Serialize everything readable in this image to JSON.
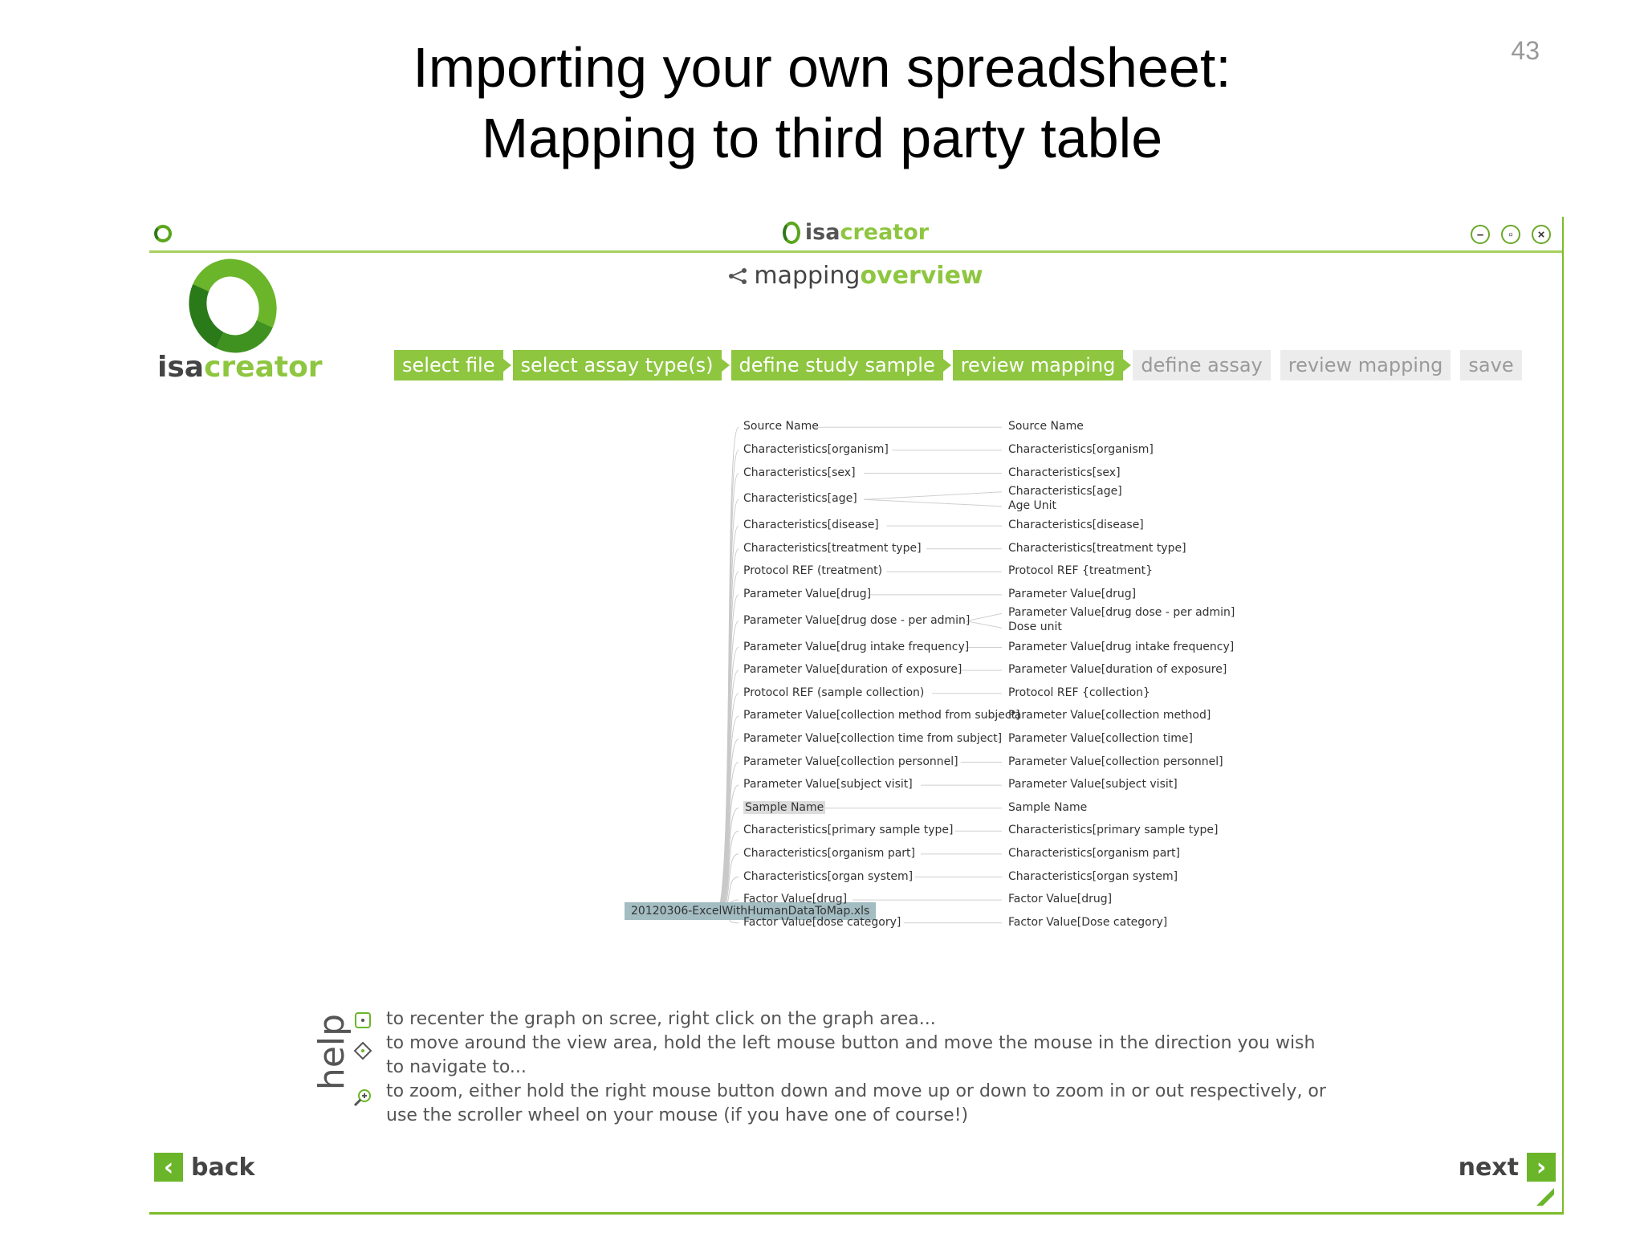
{
  "slide": {
    "title_line1": "Importing your own spreadsheet:",
    "title_line2": "Mapping to third party table",
    "page_number": "43"
  },
  "window": {
    "title_isa": "isa",
    "title_creator": "creator"
  },
  "logo": {
    "isa": "isa",
    "creator": "creator"
  },
  "heading": {
    "part1": "mapping",
    "part2": "overview"
  },
  "steps": [
    {
      "label": "select file",
      "state": "done"
    },
    {
      "label": "select assay type(s)",
      "state": "done"
    },
    {
      "label": "define study sample",
      "state": "done"
    },
    {
      "label": "review mapping",
      "state": "current"
    },
    {
      "label": "define assay",
      "state": "pending"
    },
    {
      "label": "review mapping",
      "state": "pending"
    },
    {
      "label": "save",
      "state": "pending"
    }
  ],
  "source_file": "20120306-ExcelWithHumanDataToMap.xls",
  "mappings": [
    {
      "from": "Source Name",
      "to": [
        "Source Name"
      ]
    },
    {
      "from": "Characteristics[organism]",
      "to": [
        "Characteristics[organism]"
      ]
    },
    {
      "from": "Characteristics[sex]",
      "to": [
        "Characteristics[sex]"
      ]
    },
    {
      "from": "Characteristics[age]",
      "to": [
        "Characteristics[age]",
        "Age Unit"
      ]
    },
    {
      "from": "Characteristics[disease]",
      "to": [
        "Characteristics[disease]"
      ]
    },
    {
      "from": "Characteristics[treatment type]",
      "to": [
        "Characteristics[treatment type]"
      ]
    },
    {
      "from": "Protocol REF (treatment)",
      "to": [
        "Protocol REF {treatment}"
      ]
    },
    {
      "from": "Parameter Value[drug]",
      "to": [
        "Parameter Value[drug]"
      ]
    },
    {
      "from": "Parameter Value[drug dose - per admin]",
      "to": [
        "Parameter Value[drug dose - per admin]",
        "Dose unit"
      ]
    },
    {
      "from": "Parameter Value[drug intake frequency]",
      "to": [
        "Parameter Value[drug intake frequency]"
      ]
    },
    {
      "from": "Parameter Value[duration of exposure]",
      "to": [
        "Parameter Value[duration of exposure]"
      ]
    },
    {
      "from": "Protocol REF (sample collection)",
      "to": [
        "Protocol REF {collection}"
      ]
    },
    {
      "from": "Parameter Value[collection method from subject]",
      "to": [
        "Parameter Value[collection method]"
      ]
    },
    {
      "from": "Parameter Value[collection time from subject]",
      "to": [
        "Parameter Value[collection time]"
      ]
    },
    {
      "from": "Parameter Value[collection personnel]",
      "to": [
        "Parameter Value[collection personnel]"
      ]
    },
    {
      "from": "Parameter Value[subject visit]",
      "to": [
        "Parameter Value[subject visit]"
      ]
    },
    {
      "from": "Sample Name",
      "to": [
        "Sample Name"
      ],
      "highlight": true
    },
    {
      "from": "Characteristics[primary sample type]",
      "to": [
        "Characteristics[primary sample type]"
      ]
    },
    {
      "from": "Characteristics[organism part]",
      "to": [
        "Characteristics[organism part]"
      ]
    },
    {
      "from": "Characteristics[organ system]",
      "to": [
        "Characteristics[organ system]"
      ]
    },
    {
      "from": "Factor Value[drug]",
      "to": [
        "Factor Value[drug]"
      ]
    },
    {
      "from": "Factor Value[dose category]",
      "to": [
        "Factor Value[Dose category]"
      ]
    }
  ],
  "help": {
    "title": "help",
    "recenter": "to recenter the graph on scree, right click on the graph area...",
    "move_line1": "to move around the view area, hold the left mouse button and move the mouse in the direction you wish",
    "move_line2": "to navigate to...",
    "zoom_line1": "to zoom, either hold the right mouse button down and move up or down to zoom in or out respectively, or",
    "zoom_line2": "use the scroller wheel on your mouse (if you have one of course!)"
  },
  "nav": {
    "back": "back",
    "next": "next"
  },
  "colors": {
    "accent": "#8ec640",
    "dark_green": "#2b7a1a",
    "inactive": "#ececec"
  }
}
